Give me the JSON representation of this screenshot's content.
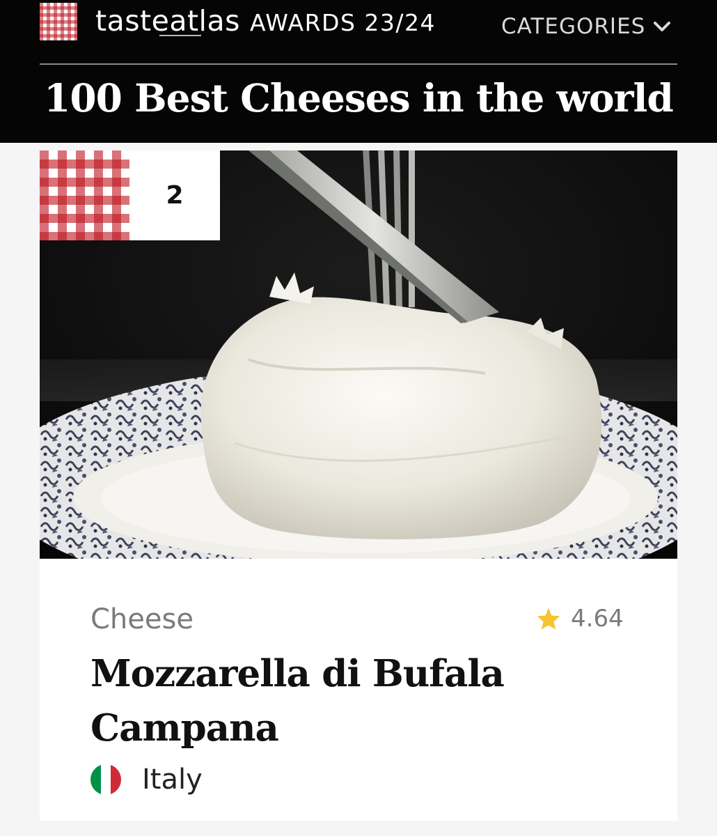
{
  "header": {
    "brand_name": "tasteatlas",
    "awards_label": "AWARDS 23/24",
    "categories_label": "CATEGORIES",
    "page_title": "100 Best Cheeses in the world"
  },
  "card": {
    "rank": "2",
    "category": "Cheese",
    "rating": "4.64",
    "name": "Mozzarella di Bufala Campana",
    "origin": "Italy",
    "image_subject": "mozzarella ball being cut with knife and fork on a blue-patterned plate"
  },
  "colors": {
    "header_bg": "#050505",
    "brand_red": "#be1e2d",
    "star": "#f4c531",
    "flag": [
      "#009246",
      "#ffffff",
      "#ce2b37"
    ]
  },
  "icons": [
    "logo-checker-icon",
    "chevron-down-icon",
    "star-icon",
    "italy-flag-icon"
  ]
}
